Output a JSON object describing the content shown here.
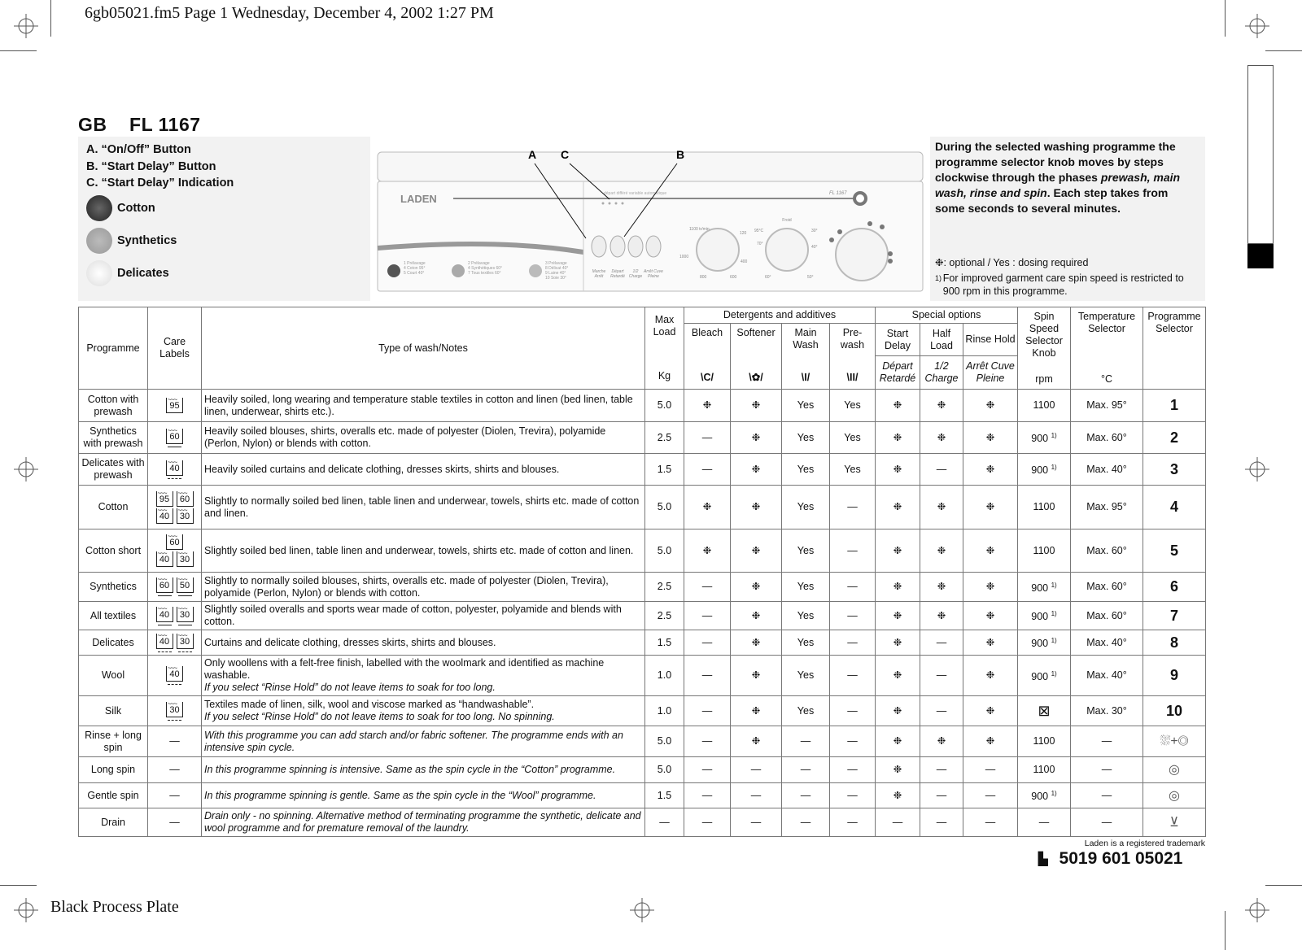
{
  "print_header": "6gb05021.fm5  Page 1  Wednesday, December 4, 2002  1:27 PM",
  "print_footer": "Black Process Plate",
  "title": "GB    FL 1167",
  "legend": {
    "items": [
      "A. “On/Off” Button",
      "B. “Start Delay” Button",
      "C. “Start Delay” Indication"
    ],
    "programmes": [
      {
        "label": "Cotton",
        "icon": "cotton-rose-icon"
      },
      {
        "label": "Synthetics",
        "icon": "synthetics-triangle-icon"
      },
      {
        "label": "Delicates",
        "icon": "delicates-icon"
      }
    ]
  },
  "panel": {
    "brand": "LADEN",
    "model": "FL 1167",
    "callouts": [
      "A",
      "C",
      "B"
    ],
    "indicator_caption": "départ différé variable automatique",
    "prog_groups": [
      [
        "1 Prélavage",
        "4 Coton 95°",
        "5 Court 40°"
      ],
      [
        "2 Prélavage",
        "4 Synthétiques 60°",
        "7 Tous textiles 60°"
      ],
      [
        "3 Prélavage",
        "8 Délicat 40°",
        "9 Laine 40°",
        "10 Soie 30°"
      ]
    ],
    "buttons": [
      [
        "Marche",
        "Arrêt"
      ],
      [
        "Départ",
        "Retardé"
      ],
      [
        "1/2",
        "Charge"
      ],
      [
        "Arrêt Cuve",
        "Pleine"
      ]
    ],
    "spin_dial": [
      "1100 tr/min",
      "120",
      "400",
      "600",
      "800",
      "1000"
    ],
    "temp_dial": [
      "Froid",
      "30°",
      "40°",
      "50°",
      "60°",
      "70°",
      "95°C"
    ]
  },
  "info": {
    "text_parts": [
      "During the selected washing programme the programme selector knob moves by steps clockwise through the phases ",
      "prewash, main wash, rinse and spin",
      ". Each step takes from some seconds to several minutes."
    ],
    "optional_note": ": optional / Yes : dosing required",
    "footnote_mark": "1)",
    "footnote": "For improved garment care spin speed is restricted to 900 rpm in this programme."
  },
  "table": {
    "headers": {
      "programme": "Programme",
      "care": "Care Labels",
      "type": "Type of wash/Notes",
      "max_load": "Max Load",
      "kg": "Kg",
      "detergents": "Detergents and additives",
      "bleach": "Bleach",
      "softener": "Softener",
      "main_wash": "Main Wash",
      "prewash": "Pre-wash",
      "special": "Special options",
      "start_delay": "Start Delay",
      "half_load": "Half Load",
      "rinse_hold": "Rinse Hold",
      "depart": "Départ Retardé",
      "half_fr": "1/2 Charge",
      "arret": "Arrêt Cuve Pleine",
      "spin": "Spin Speed Selector Knob",
      "rpm": "rpm",
      "temp": "Temperature Selector",
      "celsius": "°C",
      "prog_sel": "Programme Selector"
    },
    "symbols": {
      "optional": "❉",
      "none": "—"
    },
    "rows": [
      {
        "name": "Cotton with prewash",
        "care": [
          [
            "95",
            ""
          ]
        ],
        "notes": "Heavily soiled, long wearing and temperature stable textiles in cotton and linen (bed linen, table linen, underwear, shirts etc.).",
        "notes_it": "",
        "load": "5.0",
        "cells": [
          "❉",
          "❉",
          "Yes",
          "Yes",
          "❉",
          "❉",
          "❉"
        ],
        "spin": "1100",
        "fn": false,
        "temp": "Max. 95°",
        "prog": "1"
      },
      {
        "name": "Synthetics with prewash",
        "care": [
          [
            "60",
            "bar"
          ]
        ],
        "notes": "Heavily soiled blouses, shirts, overalls etc. made of polyester (Diolen, Trevira), polyamide (Perlon, Nylon) or blends with cotton.",
        "notes_it": "",
        "load": "2.5",
        "cells": [
          "—",
          "❉",
          "Yes",
          "Yes",
          "❉",
          "❉",
          "❉"
        ],
        "spin": "900",
        "fn": true,
        "temp": "Max. 60°",
        "prog": "2"
      },
      {
        "name": "Delicates with prewash",
        "care": [
          [
            "40",
            "dash"
          ]
        ],
        "notes": "Heavily soiled curtains and delicate clothing, dresses skirts, shirts and blouses.",
        "notes_it": "",
        "load": "1.5",
        "cells": [
          "—",
          "❉",
          "Yes",
          "Yes",
          "❉",
          "—",
          "❉"
        ],
        "spin": "900",
        "fn": true,
        "temp": "Max. 40°",
        "prog": "3"
      },
      {
        "name": "Cotton",
        "care": [
          [
            "95",
            ""
          ],
          [
            "60",
            ""
          ],
          [
            "40",
            ""
          ],
          [
            "30",
            ""
          ]
        ],
        "notes": "Slightly to normally soiled bed linen, table linen and underwear, towels, shirts etc. made of cotton and linen.",
        "notes_it": "",
        "load": "5.0",
        "cells": [
          "❉",
          "❉",
          "Yes",
          "—",
          "❉",
          "❉",
          "❉"
        ],
        "spin": "1100",
        "fn": false,
        "temp": "Max. 95°",
        "prog": "4"
      },
      {
        "name": "Cotton short",
        "care": [
          [
            "60",
            ""
          ],
          [
            "40",
            ""
          ],
          [
            "30",
            ""
          ]
        ],
        "notes": "Slightly soiled bed linen, table linen and underwear, towels, shirts etc. made of cotton and linen.",
        "notes_it": "",
        "load": "5.0",
        "cells": [
          "❉",
          "❉",
          "Yes",
          "—",
          "❉",
          "❉",
          "❉"
        ],
        "spin": "1100",
        "fn": false,
        "temp": "Max. 60°",
        "prog": "5"
      },
      {
        "name": "Synthetics",
        "care": [
          [
            "60",
            "bar"
          ],
          [
            "50",
            "bar"
          ]
        ],
        "notes": "Slightly to normally soiled blouses, shirts, overalls etc. made of polyester (Diolen, Trevira), polyamide (Perlon, Nylon) or blends with cotton.",
        "notes_it": "",
        "load": "2.5",
        "cells": [
          "—",
          "❉",
          "Yes",
          "—",
          "❉",
          "❉",
          "❉"
        ],
        "spin": "900",
        "fn": true,
        "temp": "Max. 60°",
        "prog": "6"
      },
      {
        "name": "All textiles",
        "care": [
          [
            "40",
            "bar"
          ],
          [
            "30",
            "bar"
          ]
        ],
        "notes": "Slightly soiled overalls and sports wear made of cotton, polyester, polyamide and blends with cotton.",
        "notes_it": "",
        "load": "2.5",
        "cells": [
          "—",
          "❉",
          "Yes",
          "—",
          "❉",
          "❉",
          "❉"
        ],
        "spin": "900",
        "fn": true,
        "temp": "Max. 60°",
        "prog": "7"
      },
      {
        "name": "Delicates",
        "care": [
          [
            "40",
            "dash"
          ],
          [
            "30",
            "dash"
          ]
        ],
        "notes": "Curtains and delicate clothing, dresses skirts, shirts and blouses.",
        "notes_it": "",
        "load": "1.5",
        "cells": [
          "—",
          "❉",
          "Yes",
          "—",
          "❉",
          "—",
          "❉"
        ],
        "spin": "900",
        "fn": true,
        "temp": "Max. 40°",
        "prog": "8"
      },
      {
        "name": "Wool",
        "care": [
          [
            "40",
            "dash"
          ]
        ],
        "notes": "Only woollens with a felt-free finish, labelled with the woolmark and identified as machine washable.",
        "notes_it": "If you select “Rinse Hold” do not leave items to soak for too long.",
        "load": "1.0",
        "cells": [
          "—",
          "❉",
          "Yes",
          "—",
          "❉",
          "—",
          "❉"
        ],
        "spin": "900",
        "fn": true,
        "temp": "Max. 40°",
        "prog": "9"
      },
      {
        "name": "Silk",
        "care": [
          [
            "30",
            "dash"
          ]
        ],
        "notes": "Textiles made of linen, silk, wool and viscose marked as “handwashable”.",
        "notes_it": "If you select “Rinse Hold” do not leave items to soak for too long. No spinning.",
        "load": "1.0",
        "cells": [
          "—",
          "❉",
          "Yes",
          "—",
          "❉",
          "—",
          "❉"
        ],
        "spin": "",
        "spin_icon": "no-spin-icon",
        "fn": false,
        "temp": "Max. 30°",
        "prog": "10"
      },
      {
        "name": "Rinse + long spin",
        "care": [],
        "notes": "",
        "notes_it": "With this programme you can add starch and/or fabric softener. The programme ends with an intensive spin cycle.",
        "load": "5.0",
        "cells": [
          "—",
          "❉",
          "—",
          "—",
          "❉",
          "❉",
          "❉"
        ],
        "spin": "1100",
        "fn": false,
        "temp": "—",
        "prog": "",
        "prog_icon": "rinse-plus-spin-icon"
      },
      {
        "name": "Long spin",
        "care": [],
        "notes": "",
        "notes_it": "In this programme spinning is intensive. Same as the spin cycle in the “Cotton” programme.",
        "load": "5.0",
        "cells": [
          "—",
          "—",
          "—",
          "—",
          "❉",
          "—",
          "—"
        ],
        "spin": "1100",
        "fn": false,
        "temp": "—",
        "prog": "",
        "prog_icon": "long-spin-icon"
      },
      {
        "name": "Gentle spin",
        "care": [],
        "notes": "",
        "notes_it": "In this programme spinning is gentle. Same as the spin cycle in the “Wool” programme.",
        "load": "1.5",
        "cells": [
          "—",
          "—",
          "—",
          "—",
          "❉",
          "—",
          "—"
        ],
        "spin": "900",
        "fn": true,
        "temp": "—",
        "prog": "",
        "prog_icon": "gentle-spin-icon"
      },
      {
        "name": "Drain",
        "care": [],
        "notes": "",
        "notes_it": "Drain only - no spinning. Alternative method of terminating programme the synthetic, delicate and wool programme and for premature removal of the laundry.",
        "load": "—",
        "cells": [
          "—",
          "—",
          "—",
          "—",
          "—",
          "—",
          "—"
        ],
        "spin": "—",
        "fn": false,
        "temp": "—",
        "prog": "",
        "prog_icon": "drain-icon"
      }
    ]
  },
  "trademark": "Laden is a registered trademark",
  "code": "5019 601 05021"
}
